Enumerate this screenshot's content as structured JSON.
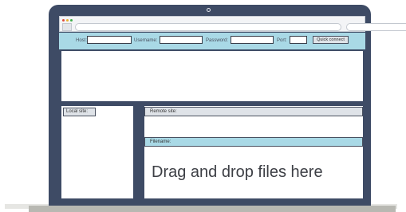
{
  "window_controls": {
    "close_color": "#e04b3c",
    "minimize_color": "#e8b230",
    "maximize_color": "#3fae49"
  },
  "quick_connect": {
    "host_label": "Host:",
    "username_label": "Username:",
    "password_label": "Password:",
    "port_label": "Port:",
    "button_label": "Quick connect",
    "host_value": "",
    "username_value": "",
    "password_value": "",
    "port_value": ""
  },
  "local_site": {
    "label": "Local site:"
  },
  "remote_site": {
    "label": "Remote site:",
    "filename_label": "Filename:",
    "drop_message": "Drag and drop files here"
  },
  "colors": {
    "laptop_frame": "#3e4b65",
    "toolbar_accent": "#a9d9e6",
    "header_gray": "#dfe3e8"
  }
}
